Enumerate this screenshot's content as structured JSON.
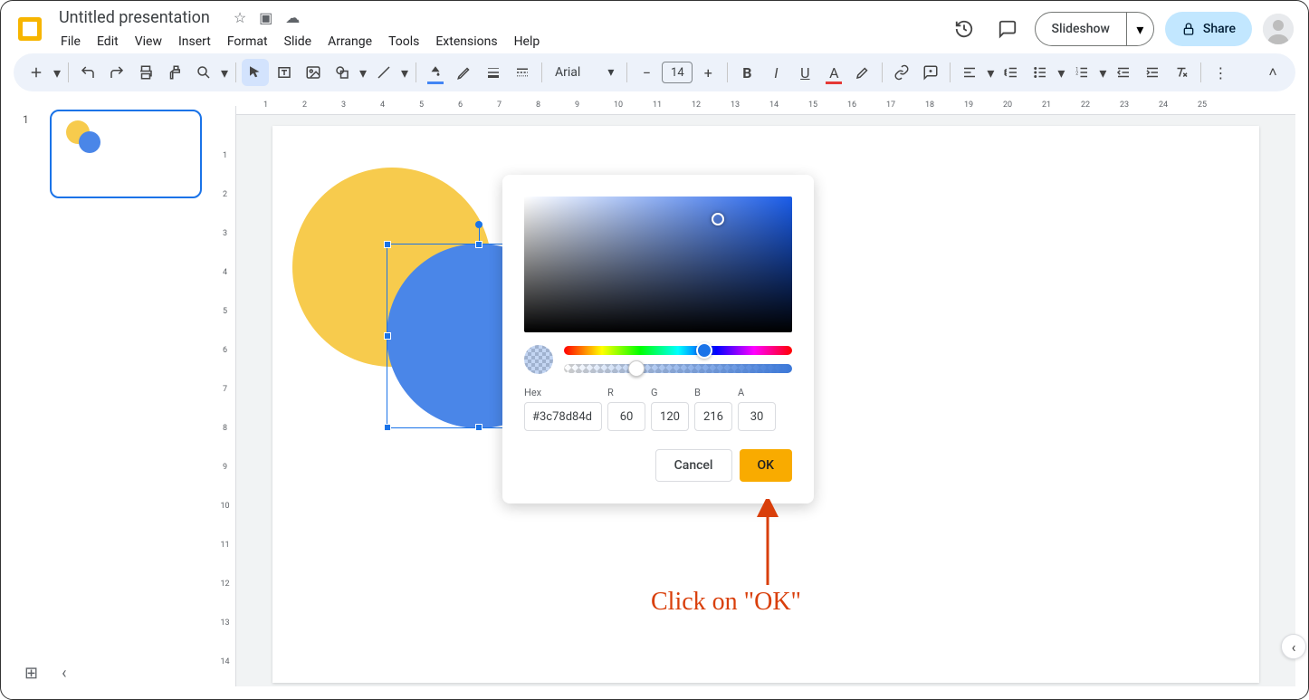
{
  "header": {
    "doc_title": "Untitled presentation",
    "menus": [
      "File",
      "Edit",
      "View",
      "Insert",
      "Format",
      "Slide",
      "Arrange",
      "Tools",
      "Extensions",
      "Help"
    ],
    "slideshow": "Slideshow",
    "share": "Share"
  },
  "toolbar": {
    "font_name": "Arial",
    "font_size": "14",
    "text_color": "#e53935",
    "fill_color_underline": "#4285f4"
  },
  "slides": {
    "current_number": "1"
  },
  "ruler_h": [
    "1",
    "2",
    "3",
    "4",
    "5",
    "6",
    "7",
    "8",
    "9",
    "10",
    "11",
    "12",
    "13",
    "14",
    "15",
    "16",
    "17",
    "18",
    "19",
    "20",
    "21",
    "22",
    "23",
    "24",
    "25"
  ],
  "ruler_v": [
    "1",
    "2",
    "3",
    "4",
    "5",
    "6",
    "7",
    "8",
    "9",
    "10",
    "11",
    "12",
    "13",
    "14"
  ],
  "canvas": {
    "yellow_circle_color": "#f7cb4d",
    "blue_circle_color": "#4a86e8"
  },
  "color_picker": {
    "labels": {
      "hex": "Hex",
      "r": "R",
      "g": "G",
      "b": "B",
      "a": "A"
    },
    "hex": "#3c78d84d",
    "r": "60",
    "g": "120",
    "b": "216",
    "a": "30",
    "cancel": "Cancel",
    "ok": "OK"
  },
  "annotation": {
    "text": "Click on \"OK\""
  }
}
